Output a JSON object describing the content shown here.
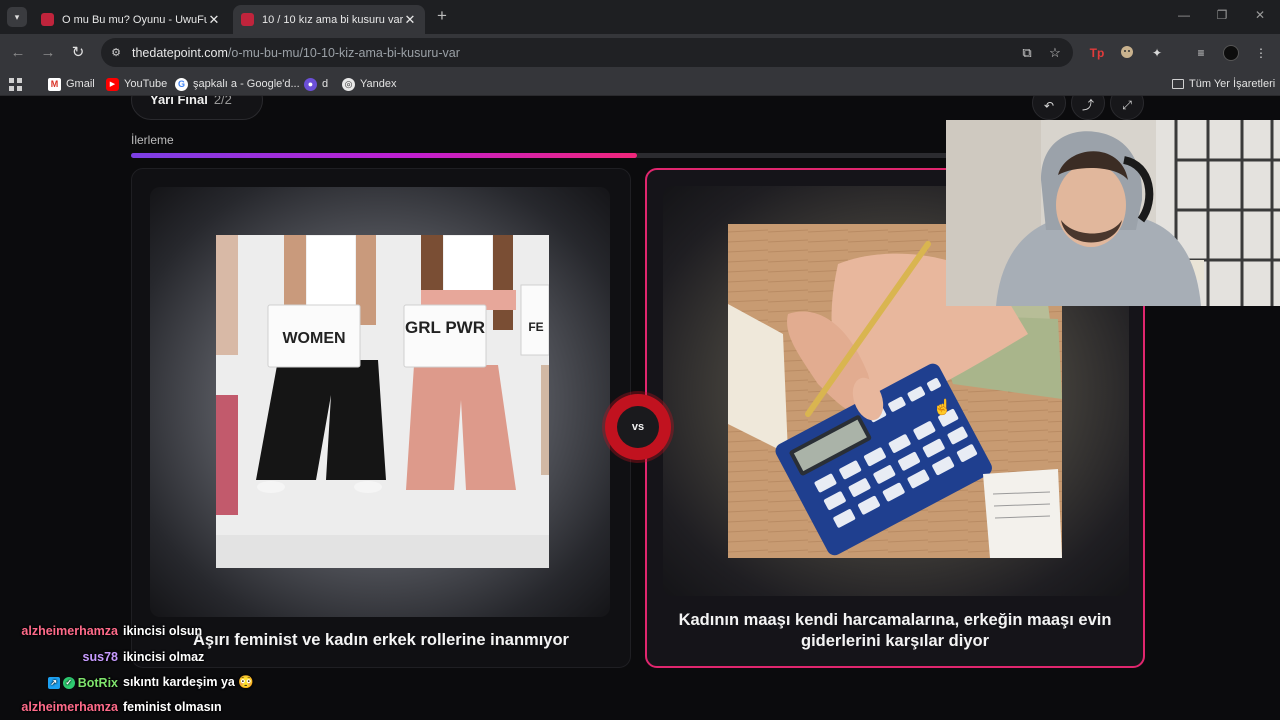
{
  "browser": {
    "tabs": [
      {
        "title": "O mu Bu mu? Oyunu - UwuFufu",
        "active": false
      },
      {
        "title": "10 / 10 kız ama bi kusuru var -",
        "active": true
      }
    ],
    "new_tab_label": "+",
    "url_host": "thedatepoint.com",
    "url_path": "/o-mu-bu-mu/10-10-kiz-ama-bi-kusuru-var",
    "bookmarks": [
      {
        "label": "Gmail",
        "icon": "gmail-icon"
      },
      {
        "label": "YouTube",
        "icon": "youtube-icon"
      },
      {
        "label": "şapkalı a - Google'd...",
        "icon": "google-icon"
      },
      {
        "label": "d",
        "icon": "avatar-icon"
      },
      {
        "label": "Yandex",
        "icon": "yandex-icon"
      }
    ],
    "all_bookmarks_label": "Tüm Yer İşaretleri"
  },
  "game": {
    "stage_label": "Yarı Final",
    "stage_count": "2/2",
    "progress_label": "İlerleme",
    "progress_percent": 50,
    "vs_label": "vs",
    "left_option": {
      "caption": "Aşırı feminist ve kadın erkek rollerine inanmıyor",
      "signs": [
        "WOMEN",
        "GRL PWR",
        "FE"
      ]
    },
    "right_option": {
      "caption": "Kadının maaşı kendi harcamalarına, erkeğin maaşı evin giderlerini karşılar diyor"
    }
  },
  "chat": [
    {
      "user": "alzheimerhamza",
      "message": "ikincisi olsun",
      "color": "#ff6b8a"
    },
    {
      "user": "sus78",
      "message": "ikincisi olmaz",
      "color": "#c79bff"
    },
    {
      "user": "BotRix",
      "message": "sıkıntı kardeşim ya 😳",
      "color": "#7ee36c"
    },
    {
      "user": "alzheimerhamza",
      "message": "feminist olmasın",
      "color": "#ff6b8a"
    }
  ]
}
